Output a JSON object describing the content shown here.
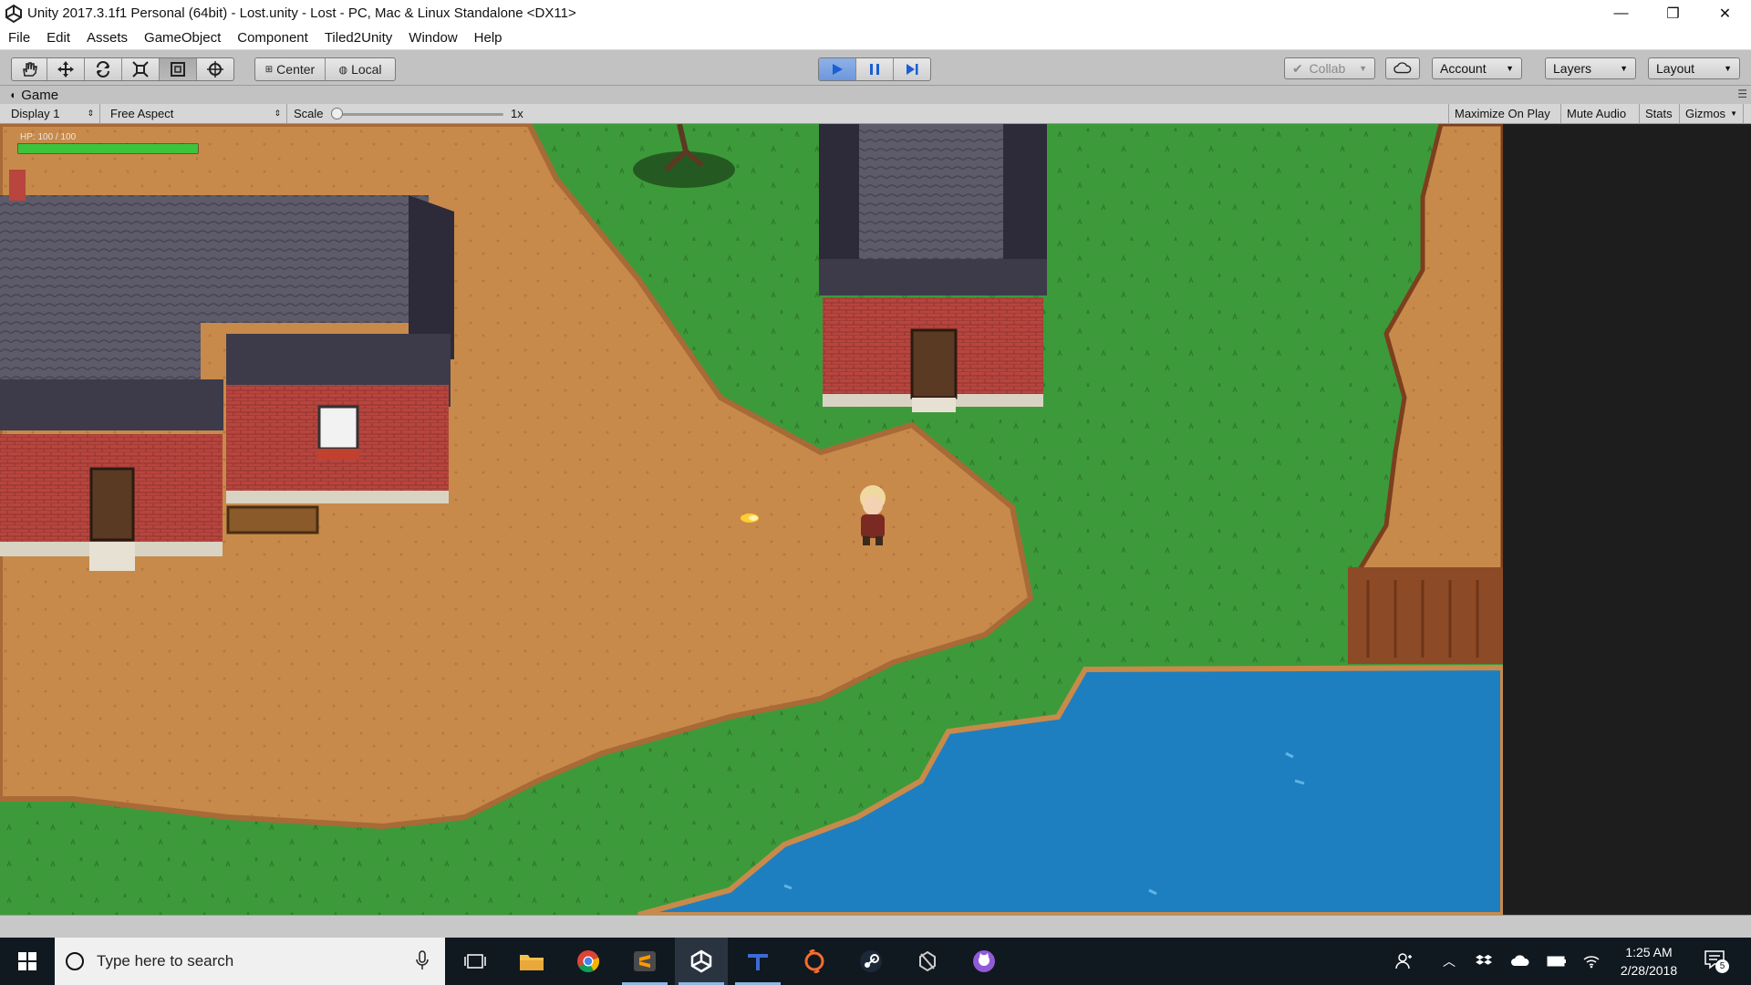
{
  "window": {
    "title": "Unity 2017.3.1f1 Personal (64bit) - Lost.unity - Lost - PC, Mac & Linux Standalone <DX11>",
    "minimize": "—",
    "maximize": "❐",
    "close": "✕"
  },
  "menu": {
    "items": [
      "File",
      "Edit",
      "Assets",
      "GameObject",
      "Component",
      "Tiled2Unity",
      "Window",
      "Help"
    ]
  },
  "toolbar": {
    "tools": [
      "hand-tool-icon",
      "move-tool-icon",
      "rotate-tool-icon",
      "scale-tool-icon",
      "rect-tool-icon",
      "transform-tool-icon"
    ],
    "pivot_center": "Center",
    "pivot_local": "Local",
    "play_state": "playing",
    "collab": "Collab",
    "account": "Account",
    "layers": "Layers",
    "layout": "Layout"
  },
  "game_tab": {
    "label": "Game",
    "display": "Display 1",
    "aspect": "Free Aspect",
    "scale_label": "Scale",
    "scale_value": "1x",
    "scale_level": 0.0,
    "maximize_on_play": "Maximize On Play",
    "mute_audio": "Mute Audio",
    "stats": "Stats",
    "gizmos": "Gizmos"
  },
  "game": {
    "hp_text": "HP: 100 / 100",
    "hp_fraction": 1.0,
    "hp_color": "#3cc43c"
  },
  "taskbar": {
    "search_placeholder": "Type here to search",
    "apps": [
      "task-view-icon",
      "file-explorer-icon",
      "chrome-icon",
      "sublime-text-icon",
      "unity-icon",
      "tiled-icon",
      "origin-icon",
      "steam-icon",
      "unity-hub-icon",
      "github-icon"
    ],
    "time": "1:25 AM",
    "date": "2/28/2018",
    "notification_count": "5"
  },
  "colors": {
    "play_active": "#6d97dc",
    "chrome": "#c2c2c2",
    "grass": "#3d9a3a",
    "dirt": "#c88a4a",
    "water": "#1d7fc0"
  }
}
